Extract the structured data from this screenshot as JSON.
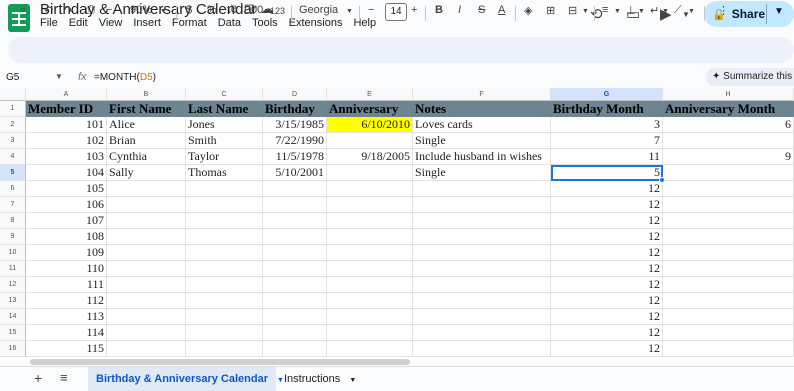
{
  "app": {
    "doc_title": "Birthday & Anniversary Calendar",
    "menu": [
      "File",
      "Edit",
      "View",
      "Insert",
      "Format",
      "Data",
      "Tools",
      "Extensions",
      "Help"
    ],
    "share_label": "Share"
  },
  "toolbar": {
    "zoom": "90%",
    "currency": "$",
    "percent": "%",
    "dec_decrease": ".0",
    "dec_increase": ".00",
    "more_formats": "123",
    "font": "Georgia",
    "font_size": "14",
    "bold": "B",
    "italic": "I",
    "strike": "S",
    "text_color": "A"
  },
  "formula_bar": {
    "cell_ref": "G5",
    "fx": "fx",
    "formula_prefix": "=MONTH(",
    "formula_ref": "D5",
    "formula_suffix": ")",
    "summarize": "Summarize this ta"
  },
  "grid": {
    "column_letters": [
      "A",
      "B",
      "C",
      "D",
      "E",
      "F",
      "G",
      "H"
    ],
    "row_numbers": [
      "1",
      "2",
      "3",
      "4",
      "5",
      "6",
      "7",
      "8",
      "9",
      "10",
      "11",
      "12",
      "13",
      "14",
      "15",
      "16"
    ],
    "header": [
      "Member ID",
      "First Name",
      "Last Name",
      "Birthday",
      "Anniversary",
      "Notes",
      "Birthday Month",
      "Anniversary Month"
    ],
    "rows": [
      [
        "101",
        "Alice",
        "Jones",
        "3/15/1985",
        "6/10/2010",
        "Loves cards",
        "3",
        "6"
      ],
      [
        "102",
        "Brian",
        "Smith",
        "7/22/1990",
        "",
        "Single",
        "7",
        ""
      ],
      [
        "103",
        "Cynthia",
        "Taylor",
        "11/5/1978",
        "9/18/2005",
        "Include husband in wishes",
        "11",
        "9"
      ],
      [
        "104",
        "Sally",
        "Thomas",
        "5/10/2001",
        "",
        "Single",
        "5",
        ""
      ],
      [
        "105",
        "",
        "",
        "",
        "",
        "",
        "12",
        ""
      ],
      [
        "106",
        "",
        "",
        "",
        "",
        "",
        "12",
        ""
      ],
      [
        "107",
        "",
        "",
        "",
        "",
        "",
        "12",
        ""
      ],
      [
        "108",
        "",
        "",
        "",
        "",
        "",
        "12",
        ""
      ],
      [
        "109",
        "",
        "",
        "",
        "",
        "",
        "12",
        ""
      ],
      [
        "110",
        "",
        "",
        "",
        "",
        "",
        "12",
        ""
      ],
      [
        "111",
        "",
        "",
        "",
        "",
        "",
        "12",
        ""
      ],
      [
        "112",
        "",
        "",
        "",
        "",
        "",
        "12",
        ""
      ],
      [
        "113",
        "",
        "",
        "",
        "",
        "",
        "12",
        ""
      ],
      [
        "114",
        "",
        "",
        "",
        "",
        "",
        "12",
        ""
      ],
      [
        "115",
        "",
        "",
        "",
        "",
        "",
        "12",
        ""
      ]
    ]
  },
  "sheets": {
    "active": "Birthday & Anniversary Calendar",
    "other": "Instructions"
  }
}
